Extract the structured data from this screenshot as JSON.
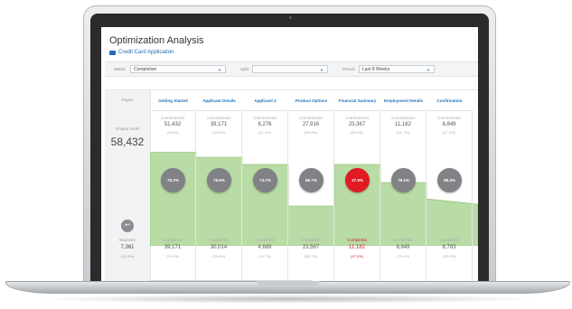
{
  "app": {
    "title": "Optimization Analysis",
    "subtitle": "Credit Card Application"
  },
  "filters": {
    "metric_label": "Metric:",
    "metric_value": "Completion",
    "split_label": "Split:",
    "split_value": "",
    "period_label": "Period:",
    "period_value": "Last 8 Weeks"
  },
  "left": {
    "pages_label": "Pages",
    "unique_visits_label": "Unique Visits",
    "unique_visits_value": "58,432",
    "bounces_label": "Bounces",
    "bounces_value": "7,361",
    "bounces_pct": "(12.6%)"
  },
  "steps": [
    {
      "name": "Getting Started",
      "commenced": "51,432",
      "commenced_pct": "(100%)",
      "rate": "76.2%",
      "completed": "39,171",
      "completed_pct": "(76.2%)",
      "rate_fraction": 0.762
    },
    {
      "name": "Applicant Details",
      "commenced": "39,171",
      "commenced_pct": "(76.2%)",
      "rate": "76.6%",
      "completed": "30,014",
      "completed_pct": "(76.6%)",
      "rate_fraction": 0.766
    },
    {
      "name": "Applicant 2",
      "commenced": "6,276",
      "commenced_pct": "(12.2%)",
      "rate": "74.7%",
      "completed": "4,689",
      "completed_pct": "(74.7%)",
      "rate_fraction": 0.747
    },
    {
      "name": "Product Options",
      "commenced": "27,916",
      "commenced_pct": "(54.3%)",
      "rate": "85.7%",
      "completed": "23,567",
      "completed_pct": "(85.7%)",
      "rate_fraction": 0.857
    },
    {
      "name": "Financial Summary",
      "commenced": "23,367",
      "commenced_pct": "(45.4%)",
      "rate": "47.9%",
      "completed": "11,182",
      "completed_pct": "(47.9%)",
      "rate_fraction": 0.479,
      "highlight": true
    },
    {
      "name": "Employment Details",
      "commenced": "11,182",
      "commenced_pct": "(21.7%)",
      "rate": "79.1%",
      "completed": "8,849",
      "completed_pct": "(79.1%)",
      "rate_fraction": 0.791
    },
    {
      "name": "Confirmation",
      "commenced": "8,849",
      "commenced_pct": "(17.2%)",
      "rate": "99.3%",
      "completed": "8,783",
      "completed_pct": "(99.3%)",
      "rate_fraction": 0.993
    }
  ],
  "labels": {
    "commenced": "Commenced",
    "completed": "Completed"
  },
  "colors": {
    "accent": "#1f6fb8",
    "funnel_fill": "#b9dba5",
    "funnel_line": "#7fbf5f",
    "highlight": "#e01b22",
    "circle": "#808285"
  }
}
